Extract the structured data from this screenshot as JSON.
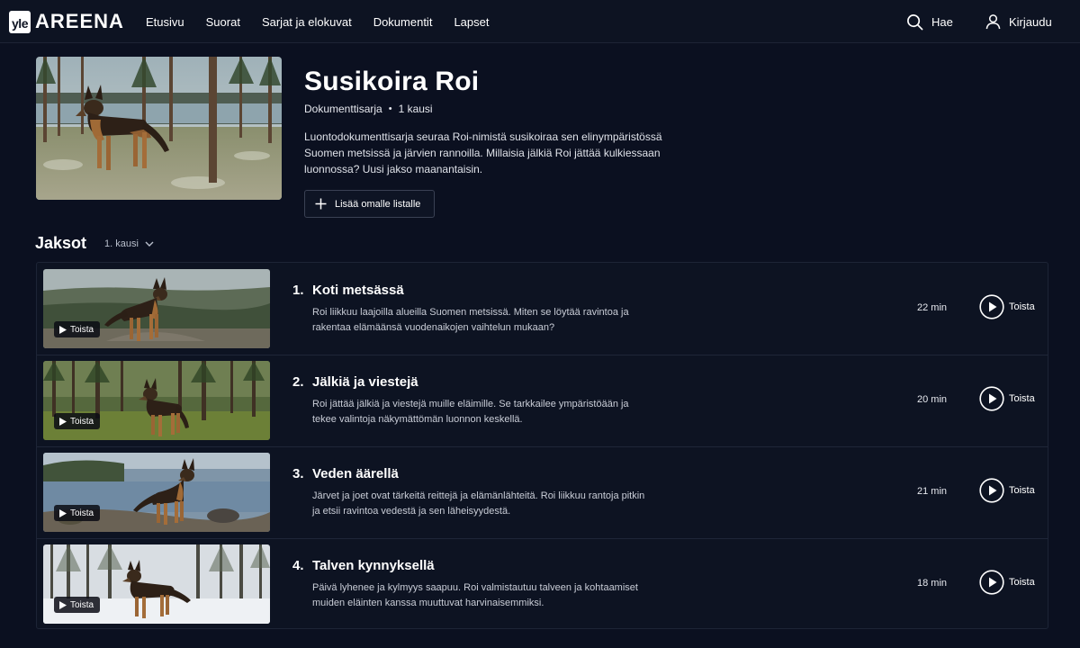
{
  "header": {
    "logo_badge": "yle",
    "logo_text": "AREENA",
    "nav": [
      "Etusivu",
      "Suorat",
      "Sarjat ja elokuvat",
      "Dokumentit",
      "Lapset"
    ],
    "search_label": "Hae",
    "login_label": "Kirjaudu"
  },
  "series": {
    "title": "Susikoira Roi",
    "type": "Dokumenttisarja",
    "separator": "•",
    "seasons": "1 kausi",
    "description": "Luontodokumenttisarja seuraa Roi-nimistä susikoiraa sen elinympäristössä Suomen metsissä ja järvien rannoilla. Millaisia jälkiä Roi jättää kulkiessaan luonnossa? Uusi jakso maanantaisin.",
    "add_to_list_label": "Lisää omalle listalle"
  },
  "episodes_section": {
    "heading": "Jaksot",
    "season_selector": "1. kausi"
  },
  "episodes": [
    {
      "number": "1.",
      "title": "Koti metsässä",
      "description": "Roi liikkuu laajoilla alueilla Suomen metsissä. Miten se löytää ravintoa ja rakentaa elämäänsä vuodenaikojen vaihtelun mukaan?",
      "duration": "22 min",
      "play_label": "Toista",
      "thumb_play_label": "Toista",
      "scene": "hilltop"
    },
    {
      "number": "2.",
      "title": "Jälkiä ja viestejä",
      "description": "Roi jättää jälkiä ja viestejä muille eläimille. Se tarkkailee ympäristöään ja tekee valintoja näkymättömän luonnon keskellä.",
      "duration": "20 min",
      "play_label": "Toista",
      "thumb_play_label": "Toista",
      "scene": "forest"
    },
    {
      "number": "3.",
      "title": "Veden äärellä",
      "description": "Järvet ja joet ovat tärkeitä reittejä ja elämänlähteitä. Roi liikkuu rantoja pitkin ja etsii ravintoa vedestä ja sen läheisyydestä.",
      "duration": "21 min",
      "play_label": "Toista",
      "thumb_play_label": "Toista",
      "scene": "lake"
    },
    {
      "number": "4.",
      "title": "Talven kynnyksellä",
      "description": "Päivä lyhenee ja kylmyys saapuu. Roi valmistautuu talveen ja kohtaamiset muiden eläinten kanssa muuttuvat harvinaisemmiksi.",
      "duration": "18 min",
      "play_label": "Toista",
      "thumb_play_label": "Toista",
      "scene": "snow"
    }
  ]
}
